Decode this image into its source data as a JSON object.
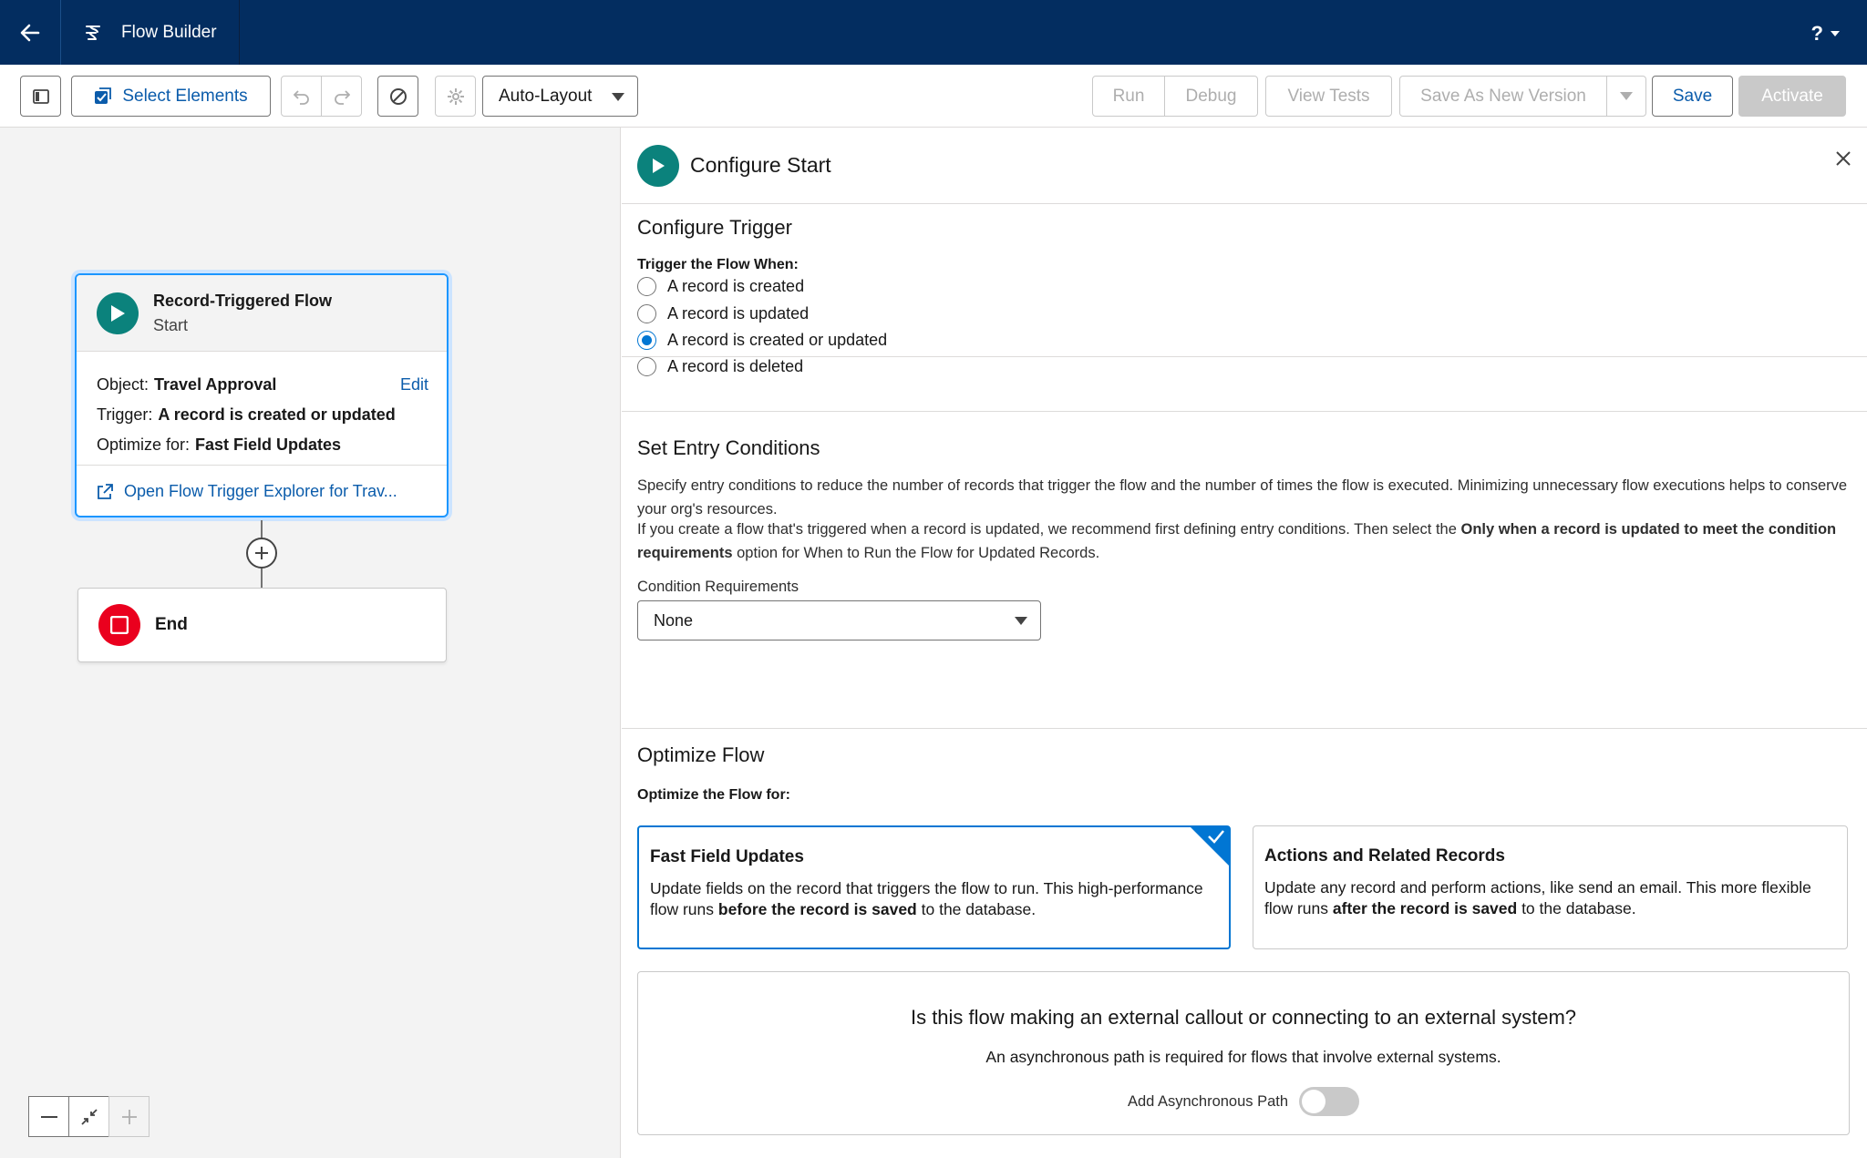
{
  "header": {
    "app_title": "Flow Builder",
    "help_label": "?"
  },
  "toolbar": {
    "select_elements": "Select Elements",
    "layout_mode": "Auto-Layout",
    "run": "Run",
    "debug": "Debug",
    "view_tests": "View Tests",
    "save_as_new_version": "Save As New Version",
    "save": "Save",
    "activate": "Activate"
  },
  "canvas": {
    "start_node": {
      "title": "Record-Triggered Flow",
      "subtitle": "Start",
      "object_label": "Object:",
      "object_value": "Travel Approval",
      "edit": "Edit",
      "trigger_label": "Trigger:",
      "trigger_value": "A record is created or updated",
      "optimize_label": "Optimize for:",
      "optimize_value": "Fast Field Updates",
      "explorer_link": "Open Flow Trigger Explorer for Trav..."
    },
    "end_node": {
      "label": "End"
    }
  },
  "panel": {
    "title": "Configure Start",
    "configure_trigger": {
      "title": "Configure Trigger",
      "field_label": "Trigger the Flow When:",
      "options": [
        "A record is created",
        "A record is updated",
        "A record is created or updated",
        "A record is deleted"
      ],
      "selected_index": 2
    },
    "entry_conditions": {
      "title": "Set Entry Conditions",
      "para1": "Specify entry conditions to reduce the number of records that trigger the flow and the number of times the flow is executed. Minimizing unnecessary flow executions helps to conserve your org's resources.",
      "para2_start": "If you create a flow that's triggered when a record is updated, we recommend first defining entry conditions. Then select the ",
      "para2_bold": "Only when a record is updated to meet the condition requirements",
      "para2_end": " option for When to Run the Flow for Updated Records.",
      "condition_label": "Condition Requirements",
      "condition_value": "None"
    },
    "optimize": {
      "title": "Optimize Flow",
      "field_label": "Optimize the Flow for:",
      "tiles": [
        {
          "title": "Fast Field Updates",
          "desc_start": "Update fields on the record that triggers the flow to run. This high-performance flow runs ",
          "desc_bold": "before the record is saved",
          "desc_end": " to the database."
        },
        {
          "title": "Actions and Related Records",
          "desc_start": "Update any record and perform actions, like send an email. This more flexible flow runs ",
          "desc_bold": "after the record is saved",
          "desc_end": " to the database."
        }
      ],
      "selected_index": 0
    },
    "async": {
      "question": "Is this flow making an external callout or connecting to an external system?",
      "desc": "An asynchronous path is required for flows that involve external systems.",
      "toggle_label": "Add Asynchronous Path",
      "toggle_on": false
    }
  },
  "colors": {
    "header_bg": "#032d60",
    "brand_blue": "#0176d3",
    "start_teal": "#0b827c",
    "end_red": "#ea001e"
  }
}
